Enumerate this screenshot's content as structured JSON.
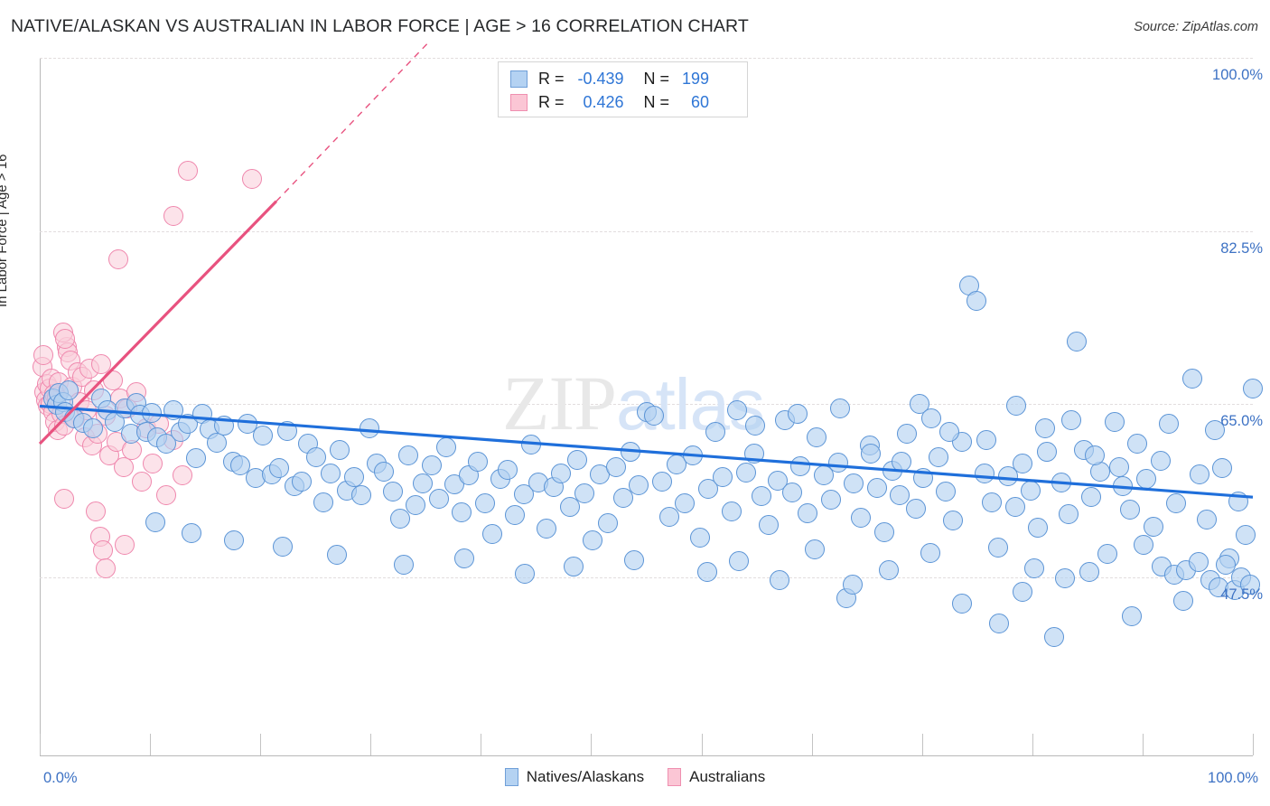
{
  "header": {
    "title": "NATIVE/ALASKAN VS AUSTRALIAN IN LABOR FORCE | AGE > 16 CORRELATION CHART",
    "source": "Source: ZipAtlas.com"
  },
  "watermark": {
    "part1": "ZIP",
    "part2": "atlas"
  },
  "stats_legend": {
    "rows": [
      {
        "series": "Natives/Alaskans",
        "r_label": "R =",
        "r_value": "-0.439",
        "n_label": "N =",
        "n_value": "199",
        "swatch": "blue"
      },
      {
        "series": "Australians",
        "r_label": "R =",
        "r_value": "0.426",
        "n_label": "N =",
        "n_value": "60",
        "swatch": "pink"
      }
    ]
  },
  "series_legend": [
    {
      "label": "Natives/Alaskans",
      "swatch": "blue"
    },
    {
      "label": "Australians",
      "swatch": "pink"
    }
  ],
  "axes": {
    "y_title": "In Labor Force | Age > 16",
    "x_min_label": "0.0%",
    "x_max_label": "100.0%",
    "y_tick_labels": [
      "100.0%",
      "82.5%",
      "65.0%",
      "47.5%"
    ]
  },
  "colors": {
    "blue_point_fill": "#b2d0f0",
    "blue_point_stroke": "#5b94d6",
    "pink_point_fill": "#facfdb",
    "pink_point_stroke": "#ef87ad",
    "blue_trend": "#1f6fdb",
    "pink_trend": "#e8527f",
    "axis_label": "#3d72c4",
    "gridline": "#e2ddde"
  },
  "chart_data": {
    "type": "scatter",
    "title": "NATIVE/ALASKAN VS AUSTRALIAN IN LABOR FORCE | AGE > 16 CORRELATION CHART",
    "xlabel": "",
    "ylabel": "In Labor Force | Age > 16",
    "xlim": [
      0,
      100
    ],
    "ylim": [
      29.5,
      100
    ],
    "x_ticks": [
      0,
      100
    ],
    "y_ticks": [
      47.5,
      65.0,
      82.5,
      100.0
    ],
    "grid": true,
    "legend_position": "bottom-center",
    "series": [
      {
        "name": "Natives/Alaskans",
        "r": -0.439,
        "n": 199,
        "color": "#b2d0f0",
        "trend": {
          "x0": 0,
          "y0": 64.8,
          "x1": 100,
          "y1": 55.6,
          "style": "solid"
        },
        "points": [
          [
            1.1,
            65.6
          ],
          [
            1.4,
            64.9
          ],
          [
            1.6,
            66.1
          ],
          [
            1.9,
            65.2
          ],
          [
            2.1,
            64.2
          ],
          [
            2.4,
            66.4
          ],
          [
            2.8,
            63.6
          ],
          [
            3.6,
            63.1
          ],
          [
            4.4,
            62.6
          ],
          [
            5.1,
            65.6
          ],
          [
            5.6,
            64.4
          ],
          [
            6.2,
            63.2
          ],
          [
            7.0,
            64.6
          ],
          [
            7.5,
            62.0
          ],
          [
            8.0,
            65.1
          ],
          [
            8.3,
            63.9
          ],
          [
            8.8,
            62.2
          ],
          [
            9.2,
            64.1
          ],
          [
            9.7,
            61.6
          ],
          [
            10.4,
            61.0
          ],
          [
            11.0,
            64.4
          ],
          [
            11.6,
            62.2
          ],
          [
            12.2,
            63.0
          ],
          [
            12.9,
            59.5
          ],
          [
            13.4,
            64.0
          ],
          [
            14.0,
            62.5
          ],
          [
            14.6,
            61.1
          ],
          [
            15.2,
            62.8
          ],
          [
            15.9,
            59.2
          ],
          [
            16.5,
            58.8
          ],
          [
            17.1,
            63.0
          ],
          [
            17.8,
            57.5
          ],
          [
            18.4,
            61.8
          ],
          [
            19.1,
            57.9
          ],
          [
            19.7,
            58.5
          ],
          [
            20.4,
            62.3
          ],
          [
            21.0,
            56.7
          ],
          [
            21.6,
            57.2
          ],
          [
            22.1,
            61.0
          ],
          [
            22.8,
            59.6
          ],
          [
            23.4,
            55.1
          ],
          [
            24.0,
            58.0
          ],
          [
            24.7,
            60.4
          ],
          [
            25.3,
            56.3
          ],
          [
            25.9,
            57.6
          ],
          [
            26.5,
            55.8
          ],
          [
            27.2,
            62.6
          ],
          [
            27.8,
            59.0
          ],
          [
            28.4,
            58.2
          ],
          [
            29.1,
            56.2
          ],
          [
            29.7,
            53.4
          ],
          [
            30.4,
            59.8
          ],
          [
            31.0,
            54.8
          ],
          [
            31.6,
            57.0
          ],
          [
            32.3,
            58.8
          ],
          [
            32.9,
            55.4
          ],
          [
            33.5,
            60.6
          ],
          [
            34.2,
            56.9
          ],
          [
            34.8,
            54.1
          ],
          [
            35.4,
            57.8
          ],
          [
            36.1,
            59.2
          ],
          [
            36.7,
            55.0
          ],
          [
            37.3,
            51.9
          ],
          [
            38.0,
            57.4
          ],
          [
            38.6,
            58.4
          ],
          [
            39.2,
            53.8
          ],
          [
            39.9,
            55.9
          ],
          [
            40.5,
            60.9
          ],
          [
            41.1,
            57.1
          ],
          [
            41.8,
            52.4
          ],
          [
            42.4,
            56.6
          ],
          [
            43.0,
            58.0
          ],
          [
            43.7,
            54.6
          ],
          [
            44.3,
            59.4
          ],
          [
            44.9,
            56.0
          ],
          [
            45.6,
            51.2
          ],
          [
            46.2,
            57.9
          ],
          [
            46.8,
            53.0
          ],
          [
            47.5,
            58.6
          ],
          [
            48.1,
            55.5
          ],
          [
            48.7,
            60.2
          ],
          [
            49.4,
            56.8
          ],
          [
            50.0,
            64.2
          ],
          [
            50.6,
            63.8
          ],
          [
            51.3,
            57.2
          ],
          [
            51.9,
            53.6
          ],
          [
            52.5,
            58.9
          ],
          [
            53.2,
            55.0
          ],
          [
            53.8,
            59.8
          ],
          [
            54.4,
            51.5
          ],
          [
            55.1,
            56.4
          ],
          [
            55.7,
            62.2
          ],
          [
            56.3,
            57.6
          ],
          [
            57.0,
            54.2
          ],
          [
            57.6,
            49.1
          ],
          [
            58.2,
            58.1
          ],
          [
            58.9,
            60.0
          ],
          [
            59.5,
            55.7
          ],
          [
            60.1,
            52.8
          ],
          [
            60.8,
            57.3
          ],
          [
            61.4,
            63.4
          ],
          [
            62.0,
            56.1
          ],
          [
            62.7,
            58.7
          ],
          [
            63.3,
            54.0
          ],
          [
            63.9,
            50.3
          ],
          [
            64.6,
            57.8
          ],
          [
            65.2,
            55.3
          ],
          [
            65.8,
            59.1
          ],
          [
            66.5,
            45.4
          ],
          [
            67.1,
            57.0
          ],
          [
            67.7,
            53.5
          ],
          [
            68.4,
            60.8
          ],
          [
            69.0,
            56.5
          ],
          [
            69.6,
            52.1
          ],
          [
            70.3,
            58.3
          ],
          [
            70.9,
            55.8
          ],
          [
            71.5,
            62.0
          ],
          [
            72.2,
            54.4
          ],
          [
            72.8,
            57.5
          ],
          [
            73.4,
            50.0
          ],
          [
            74.1,
            59.6
          ],
          [
            74.7,
            56.2
          ],
          [
            75.3,
            53.2
          ],
          [
            76.0,
            61.2
          ],
          [
            76.6,
            77.0
          ],
          [
            77.2,
            75.4
          ],
          [
            77.9,
            58.0
          ],
          [
            78.5,
            55.1
          ],
          [
            79.1,
            42.8
          ],
          [
            79.8,
            57.7
          ],
          [
            80.4,
            54.6
          ],
          [
            81.0,
            59.0
          ],
          [
            81.7,
            56.3
          ],
          [
            82.3,
            52.5
          ],
          [
            82.9,
            62.6
          ],
          [
            83.6,
            41.5
          ],
          [
            84.2,
            57.1
          ],
          [
            84.8,
            53.9
          ],
          [
            85.5,
            71.3
          ],
          [
            86.1,
            60.4
          ],
          [
            86.7,
            55.6
          ],
          [
            87.4,
            58.2
          ],
          [
            88.0,
            49.9
          ],
          [
            88.6,
            63.2
          ],
          [
            89.3,
            56.7
          ],
          [
            89.9,
            54.3
          ],
          [
            90.5,
            61.0
          ],
          [
            91.2,
            57.4
          ],
          [
            91.8,
            52.6
          ],
          [
            92.4,
            59.3
          ],
          [
            93.1,
            63.0
          ],
          [
            93.7,
            55.0
          ],
          [
            94.3,
            45.1
          ],
          [
            95.0,
            67.6
          ],
          [
            95.6,
            57.9
          ],
          [
            96.2,
            53.3
          ],
          [
            96.9,
            62.4
          ],
          [
            97.5,
            58.5
          ],
          [
            98.1,
            49.4
          ],
          [
            98.8,
            55.2
          ],
          [
            99.4,
            51.8
          ],
          [
            100.0,
            66.6
          ],
          [
            72.5,
            65.0
          ],
          [
            66.0,
            64.6
          ],
          [
            62.5,
            64.0
          ],
          [
            57.5,
            64.4
          ],
          [
            59.0,
            62.8
          ],
          [
            64.0,
            61.6
          ],
          [
            68.5,
            60.0
          ],
          [
            71.0,
            59.2
          ],
          [
            73.5,
            63.6
          ],
          [
            75.0,
            62.2
          ],
          [
            78.0,
            61.4
          ],
          [
            80.5,
            64.8
          ],
          [
            83.0,
            60.2
          ],
          [
            85.0,
            63.4
          ],
          [
            87.0,
            59.8
          ],
          [
            89.0,
            58.6
          ],
          [
            91.0,
            50.8
          ],
          [
            92.5,
            48.6
          ],
          [
            93.5,
            47.8
          ],
          [
            94.5,
            48.2
          ],
          [
            95.5,
            49.0
          ],
          [
            96.5,
            47.2
          ],
          [
            97.2,
            46.5
          ],
          [
            97.8,
            48.8
          ],
          [
            98.5,
            46.2
          ],
          [
            99.0,
            47.5
          ],
          [
            99.8,
            46.8
          ],
          [
            90.0,
            43.6
          ],
          [
            86.5,
            48.0
          ],
          [
            84.5,
            47.4
          ],
          [
            82.0,
            48.4
          ],
          [
            81.0,
            46.0
          ],
          [
            79.0,
            50.5
          ],
          [
            76.0,
            44.8
          ],
          [
            70.0,
            48.2
          ],
          [
            67.0,
            46.8
          ],
          [
            61.0,
            47.2
          ],
          [
            55.0,
            48.0
          ],
          [
            49.0,
            49.2
          ],
          [
            44.0,
            48.6
          ],
          [
            40.0,
            47.9
          ],
          [
            35.0,
            49.4
          ],
          [
            30.0,
            48.8
          ],
          [
            24.5,
            49.8
          ],
          [
            20.0,
            50.6
          ],
          [
            16.0,
            51.2
          ],
          [
            12.5,
            52.0
          ],
          [
            9.5,
            53.1
          ]
        ]
      },
      {
        "name": "Australians",
        "r": 0.426,
        "n": 60,
        "color": "#facfdb",
        "trend": {
          "x0": 0,
          "y0": 61.0,
          "x1": 19.5,
          "y1": 85.5,
          "style": "solid",
          "dashed_extension_to": [
            32.0,
            101.5
          ]
        },
        "points": [
          [
            0.2,
            68.8
          ],
          [
            0.4,
            66.2
          ],
          [
            0.5,
            65.4
          ],
          [
            0.6,
            67.0
          ],
          [
            0.7,
            64.8
          ],
          [
            0.8,
            66.6
          ],
          [
            0.9,
            65.0
          ],
          [
            1.0,
            67.6
          ],
          [
            1.1,
            64.2
          ],
          [
            1.2,
            66.0
          ],
          [
            1.3,
            63.2
          ],
          [
            1.4,
            65.8
          ],
          [
            1.5,
            62.4
          ],
          [
            1.6,
            67.2
          ],
          [
            1.8,
            64.0
          ],
          [
            2.0,
            62.8
          ],
          [
            2.2,
            70.8
          ],
          [
            2.3,
            70.2
          ],
          [
            2.5,
            69.4
          ],
          [
            2.7,
            66.8
          ],
          [
            2.9,
            63.6
          ],
          [
            3.1,
            68.2
          ],
          [
            3.3,
            65.2
          ],
          [
            3.5,
            67.8
          ],
          [
            3.7,
            61.6
          ],
          [
            3.9,
            64.4
          ],
          [
            4.1,
            68.6
          ],
          [
            4.3,
            60.8
          ],
          [
            4.5,
            66.4
          ],
          [
            4.8,
            62.0
          ],
          [
            5.1,
            69.0
          ],
          [
            5.4,
            63.8
          ],
          [
            5.7,
            59.8
          ],
          [
            6.0,
            67.4
          ],
          [
            6.3,
            61.2
          ],
          [
            6.6,
            65.6
          ],
          [
            6.9,
            58.6
          ],
          [
            7.2,
            64.6
          ],
          [
            7.6,
            60.4
          ],
          [
            8.0,
            66.2
          ],
          [
            8.4,
            57.2
          ],
          [
            8.8,
            62.6
          ],
          [
            9.3,
            59.0
          ],
          [
            9.8,
            63.0
          ],
          [
            10.4,
            55.8
          ],
          [
            11.0,
            61.4
          ],
          [
            11.8,
            57.8
          ],
          [
            1.9,
            72.2
          ],
          [
            2.1,
            71.6
          ],
          [
            0.3,
            70.0
          ],
          [
            4.6,
            54.2
          ],
          [
            5.0,
            51.6
          ],
          [
            5.2,
            50.2
          ],
          [
            5.4,
            48.4
          ],
          [
            7.0,
            50.8
          ],
          [
            2.0,
            55.4
          ],
          [
            6.5,
            79.6
          ],
          [
            12.2,
            88.6
          ],
          [
            11.0,
            84.0
          ],
          [
            17.5,
            87.8
          ]
        ]
      }
    ]
  }
}
